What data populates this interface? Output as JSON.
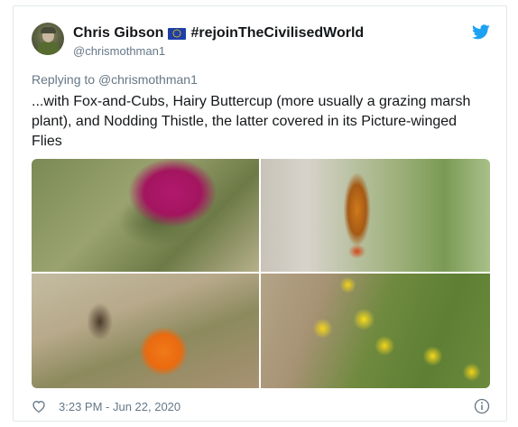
{
  "tweet": {
    "display_name": "Chris Gibson",
    "hashtag": "#rejoinTheCivilisedWorld",
    "handle": "@chrismothman1",
    "replying_prefix": "Replying to",
    "replying_to": "@chrismothman1",
    "text": "...with Fox-and-Cubs, Hairy Buttercup (more usually a grazing marsh plant), and Nodding Thistle, the latter covered in its Picture-winged Flies",
    "timestamp": "3:23 PM - Jun 22, 2020"
  },
  "icons": {
    "brand": "twitter-bird-icon",
    "flag": "eu-flag-icon",
    "like": "heart-icon",
    "info": "info-icon"
  },
  "colors": {
    "twitter_blue": "#1da1f2",
    "muted_text": "#657786",
    "primary_text": "#14171a",
    "border": "#e1e8ed"
  }
}
